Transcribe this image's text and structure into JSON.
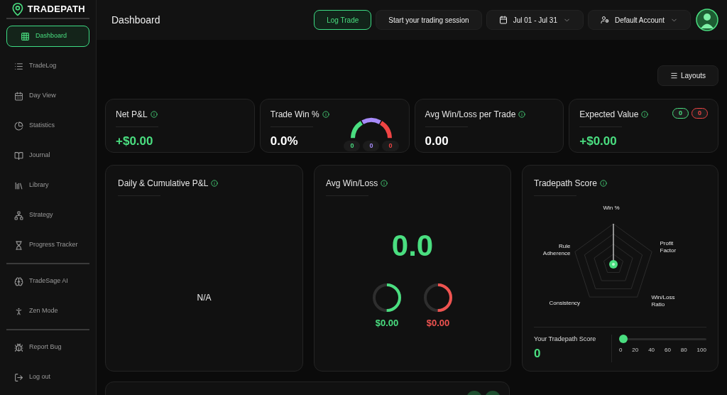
{
  "brand": {
    "name": "TRADEPATH"
  },
  "sidebar": {
    "groups": [
      [
        {
          "label": "Dashboard",
          "selected": true
        },
        {
          "label": "TradeLog",
          "selected": false
        },
        {
          "label": "Day View",
          "selected": false
        },
        {
          "label": "Statistics",
          "selected": false
        },
        {
          "label": "Journal",
          "selected": false
        },
        {
          "label": "Library",
          "selected": false
        },
        {
          "label": "Strategy",
          "selected": false
        },
        {
          "label": "Progress Tracker",
          "selected": false
        }
      ],
      [
        {
          "label": "TradeSage AI",
          "selected": false
        },
        {
          "label": "Zen Mode",
          "selected": false
        }
      ],
      [
        {
          "label": "Report Bug",
          "selected": false
        },
        {
          "label": "Log out",
          "selected": false
        }
      ]
    ]
  },
  "header": {
    "title": "Dashboard",
    "buttons": [
      {
        "kind": "primary",
        "label": "Log Trade"
      },
      {
        "kind": "plain",
        "label": "Start your trading session"
      },
      {
        "kind": "date",
        "label": "Jul 01 - Jul 31"
      },
      {
        "kind": "account",
        "label": "Default Account"
      }
    ]
  },
  "layouts_button": {
    "label": "Layouts"
  },
  "stat_cards": [
    {
      "kind": "plain",
      "title": "Net P&L",
      "value": "+$0.00",
      "positive": true
    },
    {
      "kind": "gauge",
      "title": "Trade Win %",
      "value": "0.0%",
      "positive": false,
      "badges": [
        {
          "text": "0",
          "color": "#4ade80"
        },
        {
          "text": "0",
          "color": "#a78bfa"
        },
        {
          "text": "0",
          "color": "#ef4444"
        }
      ]
    },
    {
      "kind": "plain",
      "title": "Avg Win/Loss per Trade",
      "value": "0.00",
      "positive": false
    },
    {
      "kind": "badges",
      "title": "Expected Value",
      "value": "+$0.00",
      "positive": true,
      "badges": [
        {
          "text": "0",
          "color": "#4ade80"
        },
        {
          "text": "0",
          "color": "#ef4444"
        }
      ]
    }
  ],
  "daily_pnl": {
    "title": "Daily & Cumulative P&L",
    "empty_text": "N/A"
  },
  "avg_win_loss": {
    "title": "Avg Win/Loss",
    "value": "0.0",
    "rings": [
      {
        "amount": "$0.00",
        "color": "#4ade80"
      },
      {
        "amount": "$0.00",
        "color": "#ef5350"
      }
    ]
  },
  "score": {
    "title": "Tradepath Score",
    "axes": [
      "Win %",
      "Rule Adherence",
      "Profit Factor",
      "Consistency",
      "Win/Loss Ratio"
    ],
    "score_label": "Your Tradepath Score",
    "score_value": "0",
    "slider": {
      "level": 0
    },
    "ticks": [
      "0",
      "20",
      "40",
      "60",
      "80",
      "100"
    ]
  }
}
